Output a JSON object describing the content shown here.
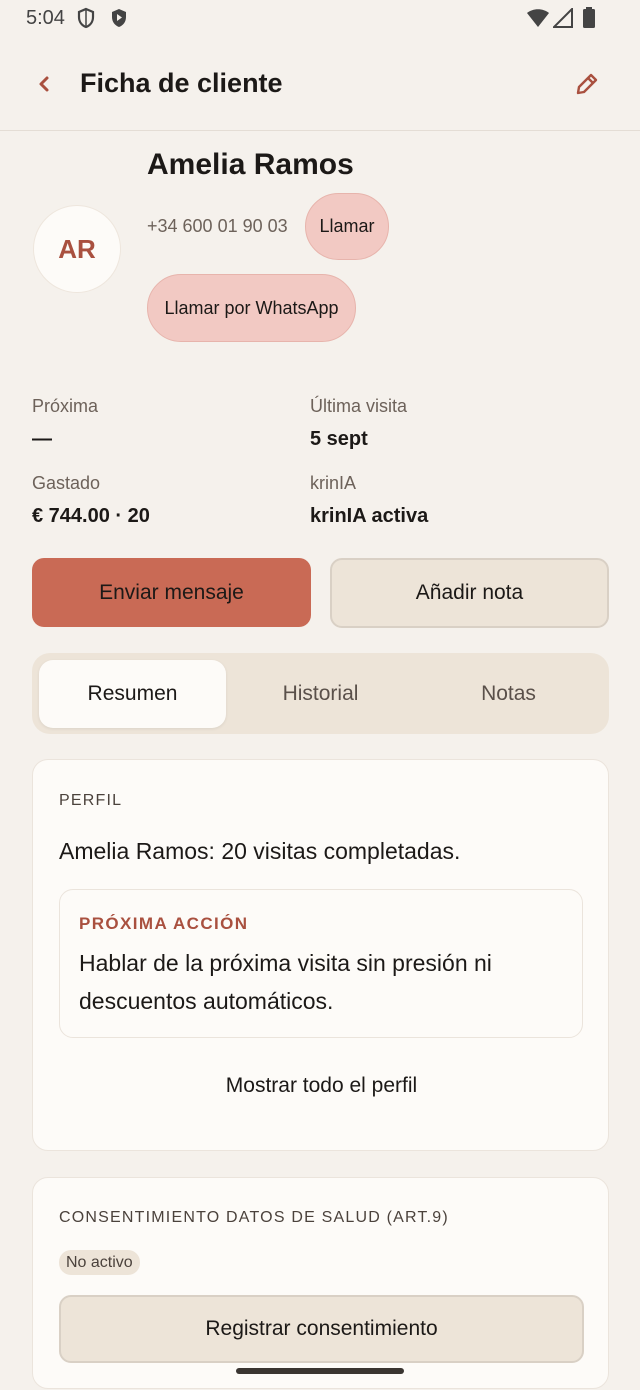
{
  "status_bar": {
    "time": "5:04"
  },
  "app_bar": {
    "title": "Ficha de cliente",
    "back_icon": "chevron-left-icon",
    "edit_icon": "pencil-icon"
  },
  "client": {
    "initials": "AR",
    "name": "Amelia Ramos",
    "phone": "+34 600 01 90 03",
    "call_label": "Llamar",
    "whatsapp_label": "Llamar por WhatsApp"
  },
  "stats": {
    "next_label": "Próxima",
    "next_value": "—",
    "last_visit_label": "Última visita",
    "last_visit_value": "5 sept",
    "spent_label": "Gastado",
    "spent_value": "€ 744.00 · 20",
    "ai_label": "krinIA",
    "ai_value": "krinIA activa"
  },
  "actions": {
    "send_message": "Enviar mensaje",
    "add_note": "Añadir nota"
  },
  "tabs": [
    {
      "label": "Resumen",
      "active": true
    },
    {
      "label": "Historial",
      "active": false
    },
    {
      "label": "Notas",
      "active": false
    }
  ],
  "profile_card": {
    "section_label": "PERFIL",
    "summary": "Amelia Ramos: 20 visitas completadas.",
    "next_action_label": "PRÓXIMA ACCIÓN",
    "next_action_text": "Hablar de la próxima visita sin presión ni descuentos automáticos.",
    "show_all_label": "Mostrar todo el perfil"
  },
  "consent_card": {
    "section_label": "CONSENTIMIENTO DATOS DE SALUD (ART.9)",
    "status_badge": "No activo",
    "register_label": "Registrar consentimiento"
  },
  "colors": {
    "background": "#f5f1ec",
    "accent": "#c96a55",
    "accent_text": "#a9503f",
    "pill": "#f2c9c3",
    "surface": "#fdfbf8",
    "muted_surface": "#ede4d8"
  }
}
